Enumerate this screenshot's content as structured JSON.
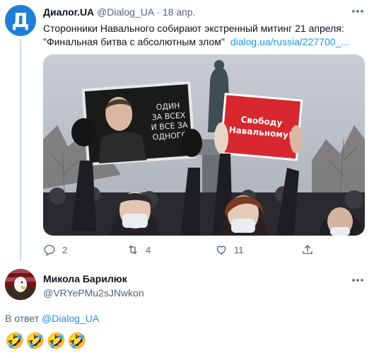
{
  "tweet": {
    "avatar_letter": "Д",
    "author_name": "Диалог.UA",
    "author_handle": "@Dialog_UA",
    "separator": "·",
    "date": "18 апр.",
    "text": "Сторонники Навального собирают экстренный митинг 21 апреля: \"Финальная битва с абсолютным злом\"",
    "link": "dialog.ua/russia/227700_...",
    "image": {
      "sign_left_text": [
        "ОДИН",
        "ЗА ВСЕХ",
        "И ВСЕ ЗА",
        "ОДНОГО"
      ],
      "sign_right_text": [
        "Свободу",
        "Навальному!"
      ]
    },
    "actions": {
      "reply_count": "2",
      "retweet_count": "4",
      "like_count": "11"
    },
    "icons": [
      "more-icon",
      "reply-icon",
      "retweet-icon",
      "like-icon",
      "share-icon"
    ]
  },
  "reply": {
    "author_name": "Микола Барилюк",
    "author_handle": "@VRYePMu2sJNwkon",
    "reply_prefix": "В ответ",
    "reply_to": "@Dialog_UA",
    "text": "🤣🤣🤣🤣"
  },
  "colors": {
    "link": "#1b95e0",
    "secondary_text": "#536471",
    "avatar_blue": "#1d7fd6"
  }
}
